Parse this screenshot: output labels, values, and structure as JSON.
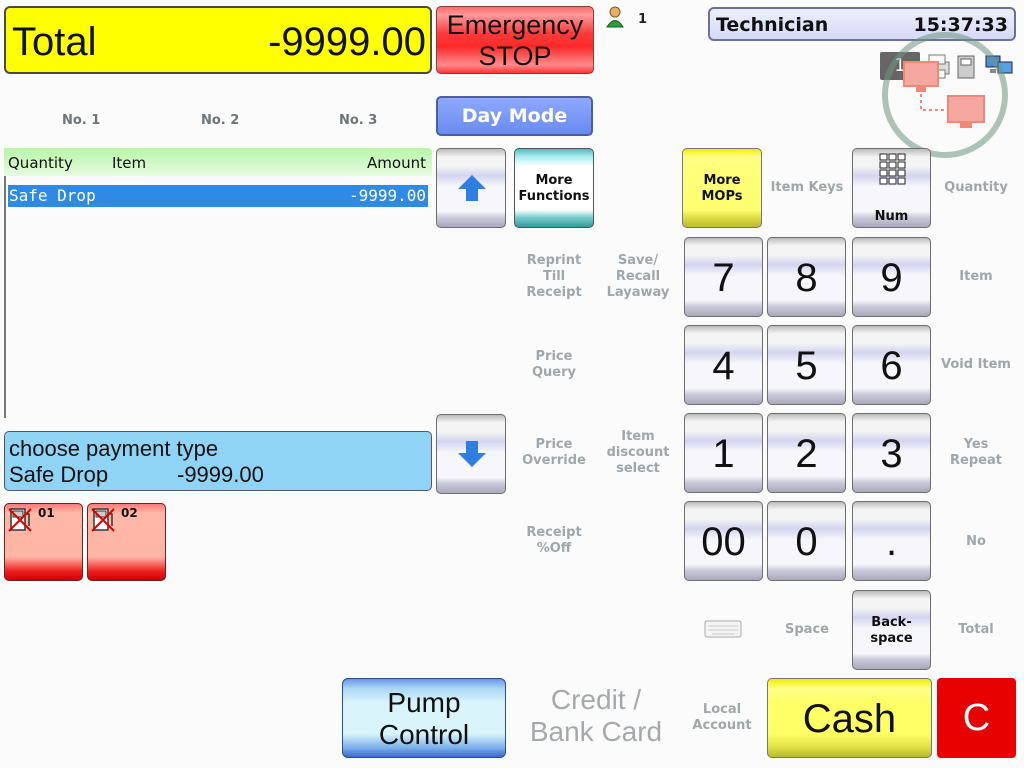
{
  "total": {
    "label": "Total",
    "value": "-9999.00"
  },
  "emergency": {
    "line1": "Emergency",
    "line2": "STOP"
  },
  "user_count": "1",
  "header": {
    "operator": "Technician",
    "time": "15:37:33"
  },
  "tray": {
    "badge": "1"
  },
  "tills": [
    "No. 1",
    "No. 2",
    "No. 3"
  ],
  "day_mode": "Day Mode",
  "receipt": {
    "col_quantity": "Quantity",
    "col_item": "Item",
    "col_amount": "Amount",
    "line_item": "Safe Drop",
    "line_amount": "-9999.00"
  },
  "message": {
    "line1": "choose payment type",
    "line2_label": "Safe Drop",
    "line2_value": "-9999.00"
  },
  "pumps": [
    "01",
    "02"
  ],
  "more_functions": {
    "l1": "More",
    "l2": "Functions"
  },
  "more_mops": {
    "l1": "More",
    "l2": "MOPs"
  },
  "num_key": "Num",
  "labels": {
    "item_keys": "Item Keys",
    "quantity": "Quantity",
    "reprint": [
      "Reprint",
      "Till",
      "Receipt"
    ],
    "save_recall": [
      "Save/",
      "Recall",
      "Layaway"
    ],
    "item": "Item",
    "price_query": [
      "Price",
      "Query"
    ],
    "void_item": "Void Item",
    "price_override": [
      "Price",
      "Override"
    ],
    "item_discount": [
      "Item",
      "discount",
      "select"
    ],
    "yes_repeat": [
      "Yes",
      "Repeat"
    ],
    "receipt_off": [
      "Receipt",
      "%Off"
    ],
    "no": "No",
    "space": "Space",
    "total": "Total",
    "local_account": [
      "Local",
      "Account"
    ]
  },
  "backspace": {
    "l1": "Back-",
    "l2": "space"
  },
  "digits": {
    "k7": "7",
    "k8": "8",
    "k9": "9",
    "k4": "4",
    "k5": "5",
    "k6": "6",
    "k1": "1",
    "k2": "2",
    "k3": "3",
    "k00": "00",
    "k0": "0",
    "kdot": "."
  },
  "pump_control": {
    "l1": "Pump",
    "l2": "Control"
  },
  "credit": {
    "l1": "Credit /",
    "l2": "Bank Card"
  },
  "cash": "Cash",
  "clear": "C",
  "colors": {
    "total_bg": "#ffff00",
    "selected_line": "#2f8ae5",
    "message_bg": "#8fd4f5",
    "clear_bg": "#e60000"
  }
}
